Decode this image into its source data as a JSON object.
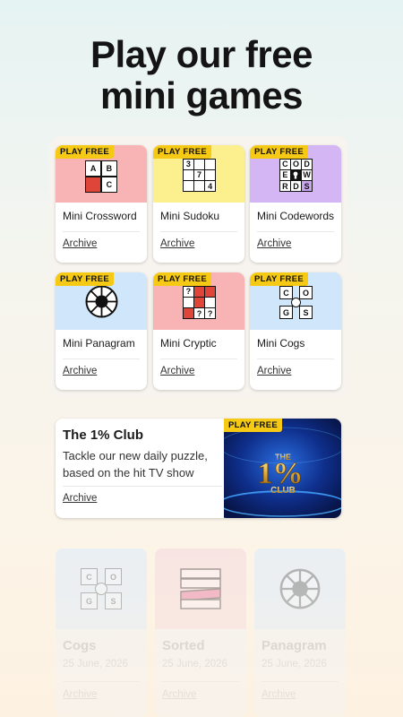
{
  "headline": {
    "line1": "Play our free",
    "line2": "mini games"
  },
  "badge": "PLAY FREE",
  "archive_label": "Archive",
  "colors": {
    "badge": "#f6c915",
    "crossword": "#f8b4b4",
    "sudoku": "#fbf08d",
    "codewords": "#d4b6f5",
    "panagram": "#cfe6fb",
    "cryptic": "#f8b4b4",
    "cogs": "#cfe6fb"
  },
  "mini_games": [
    {
      "name": "Mini Crossword",
      "icon": "crossword-grid-icon",
      "cells": [
        "A",
        "B",
        "",
        "C"
      ]
    },
    {
      "name": "Mini Sudoku",
      "icon": "sudoku-grid-icon",
      "cells": [
        "3",
        "",
        "",
        "",
        "7",
        "",
        "",
        "",
        "4"
      ]
    },
    {
      "name": "Mini Codewords",
      "icon": "codewords-grid-icon",
      "cells": [
        "C",
        "O",
        "D",
        "E",
        "",
        "W",
        "R",
        "D",
        "S"
      ]
    },
    {
      "name": "Mini Panagram",
      "icon": "panagram-wheel-icon"
    },
    {
      "name": "Mini Cryptic",
      "icon": "cryptic-grid-icon",
      "cells": [
        "?",
        "",
        "",
        "",
        "",
        "",
        "",
        "?",
        "?"
      ]
    },
    {
      "name": "Mini Cogs",
      "icon": "cogs-icon",
      "cells": [
        "C",
        "O",
        "G",
        "S"
      ]
    }
  ],
  "club": {
    "title": "The 1% Club",
    "description": "Tackle our new daily puzzle, based on the hit TV show",
    "archive": "Archive",
    "logo_text": {
      "line1": "THE",
      "big": "1%",
      "line3": "CLUB"
    }
  },
  "recent": [
    {
      "name": "Cogs",
      "date": "25 June, 2026",
      "archive": "Archive",
      "icon": "cogs-icon",
      "cells": [
        "C",
        "O",
        "G",
        "S"
      ]
    },
    {
      "name": "Sorted",
      "date": "25 June, 2026",
      "archive": "Archive",
      "icon": "sorted-bars-icon"
    },
    {
      "name": "Panagram",
      "date": "25 June, 2026",
      "archive": "Archive",
      "icon": "panagram-wheel-icon"
    }
  ]
}
